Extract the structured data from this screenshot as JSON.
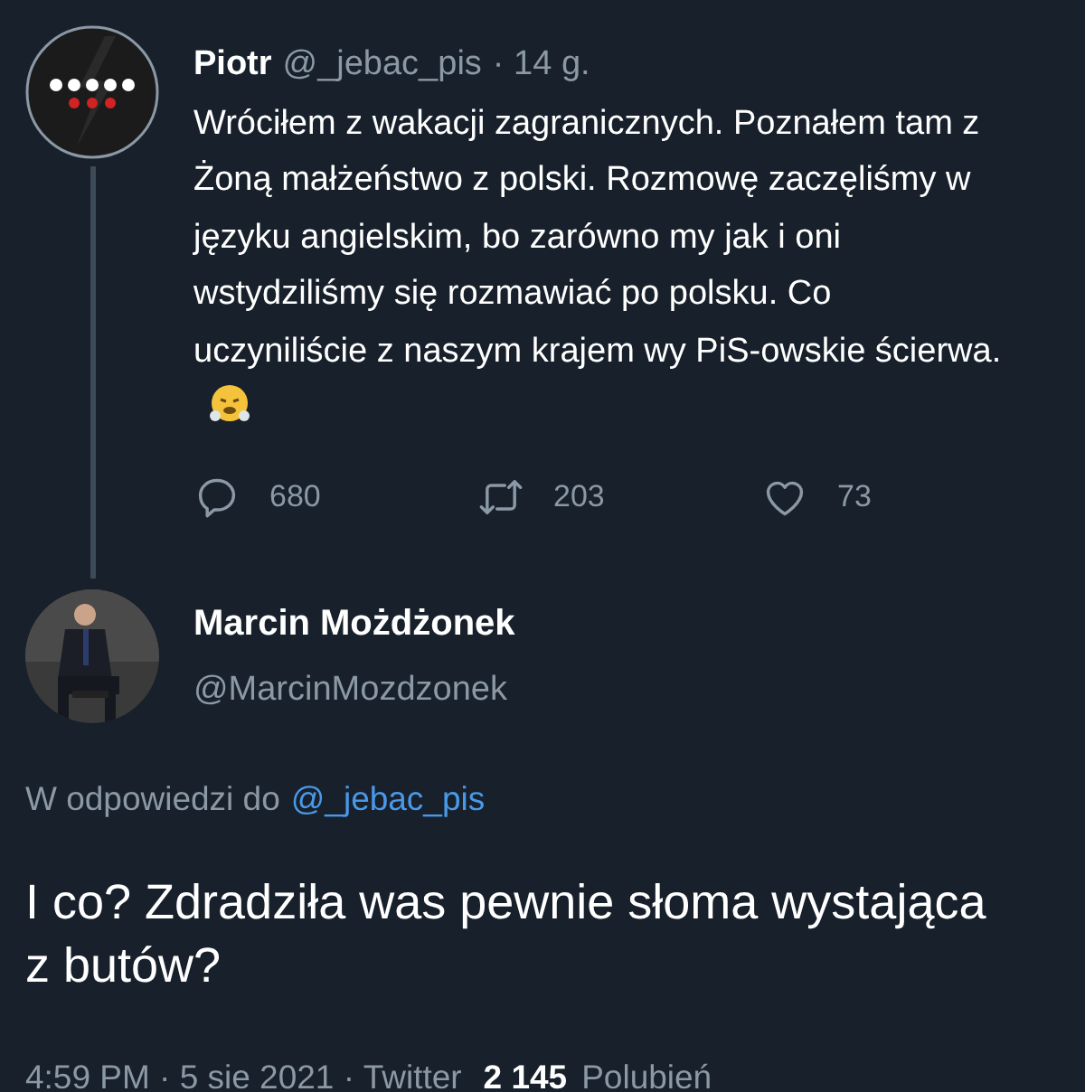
{
  "tweet": {
    "name": "Piotr",
    "handle": "@_jebac_pis",
    "time": "· 14 g.",
    "text": "Wróciłem z wakacji zagranicznych. Poznałem tam z Żoną małżeństwo z polski. Rozmowę zaczęliśmy w języku angielskim, bo zarówno my jak i oni wstydziliśmy się rozmawiać po polsku. Co uczyniliście z naszym krajem wy PiS-owskie ścierwa.",
    "actions": [
      {
        "kind": "reply",
        "count": "680"
      },
      {
        "kind": "retweet",
        "count": "203"
      },
      {
        "kind": "like",
        "count": "73"
      }
    ]
  },
  "reply": {
    "name": "Marcin Możdżonek",
    "handle": "@MarcinMozdzonek",
    "in_reply_prefix": "W odpowiedzi do",
    "in_reply_handle": "@_jebac_pis",
    "text": "I co? Zdradziła was pewnie słoma wystająca z butów?",
    "meta": "4:59 PM · 5 sie 2021 · Twitter",
    "likes_count": "2 145",
    "likes_label": "Polubień"
  }
}
